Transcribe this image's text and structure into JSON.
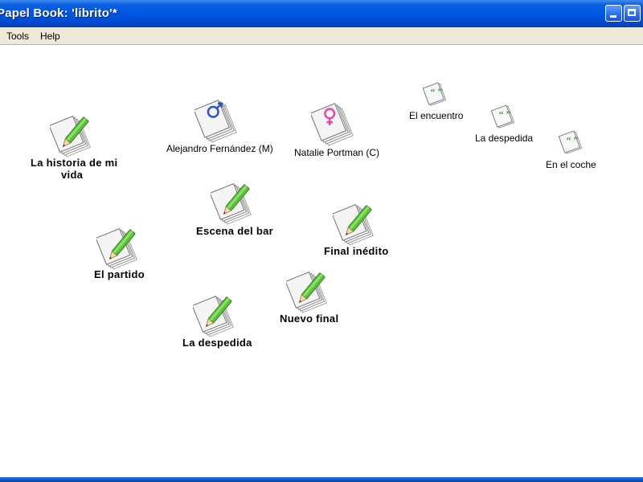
{
  "window": {
    "title": "Papel Book: 'librito'*",
    "controls": [
      "minimize",
      "maximize"
    ]
  },
  "menu": {
    "items": [
      "Tools",
      "Help"
    ]
  },
  "canvas": {
    "characters": [
      {
        "label": "Alejandro Fernández (M)",
        "icon": "male-symbol-document-icon"
      },
      {
        "label": "Natalie Portman (C)",
        "icon": "female-symbol-document-icon"
      }
    ],
    "dialogues": [
      {
        "label": "El encuentro",
        "icon": "quote-document-icon"
      },
      {
        "label": "La despedida",
        "icon": "quote-document-icon"
      },
      {
        "label": "En el coche",
        "icon": "quote-document-icon"
      }
    ],
    "scenes": [
      {
        "label_line1": "La historia de mi",
        "label_line2": "vida",
        "icon": "pencil-document-icon"
      },
      {
        "label": "Escena del bar",
        "icon": "pencil-document-icon"
      },
      {
        "label": "Final inédito",
        "icon": "pencil-document-icon"
      },
      {
        "label": "El partido",
        "icon": "pencil-document-icon"
      },
      {
        "label": "Nuevo final",
        "icon": "pencil-document-icon"
      },
      {
        "label": "La despedida",
        "icon": "pencil-document-icon"
      }
    ]
  },
  "colors": {
    "titlebar": "#0054e3",
    "menubar": "#ece9d8",
    "pencil": "#5cc23c",
    "male_symbol": "#3355bb",
    "female_symbol": "#e04aa8",
    "quote": "#3aa83a"
  }
}
